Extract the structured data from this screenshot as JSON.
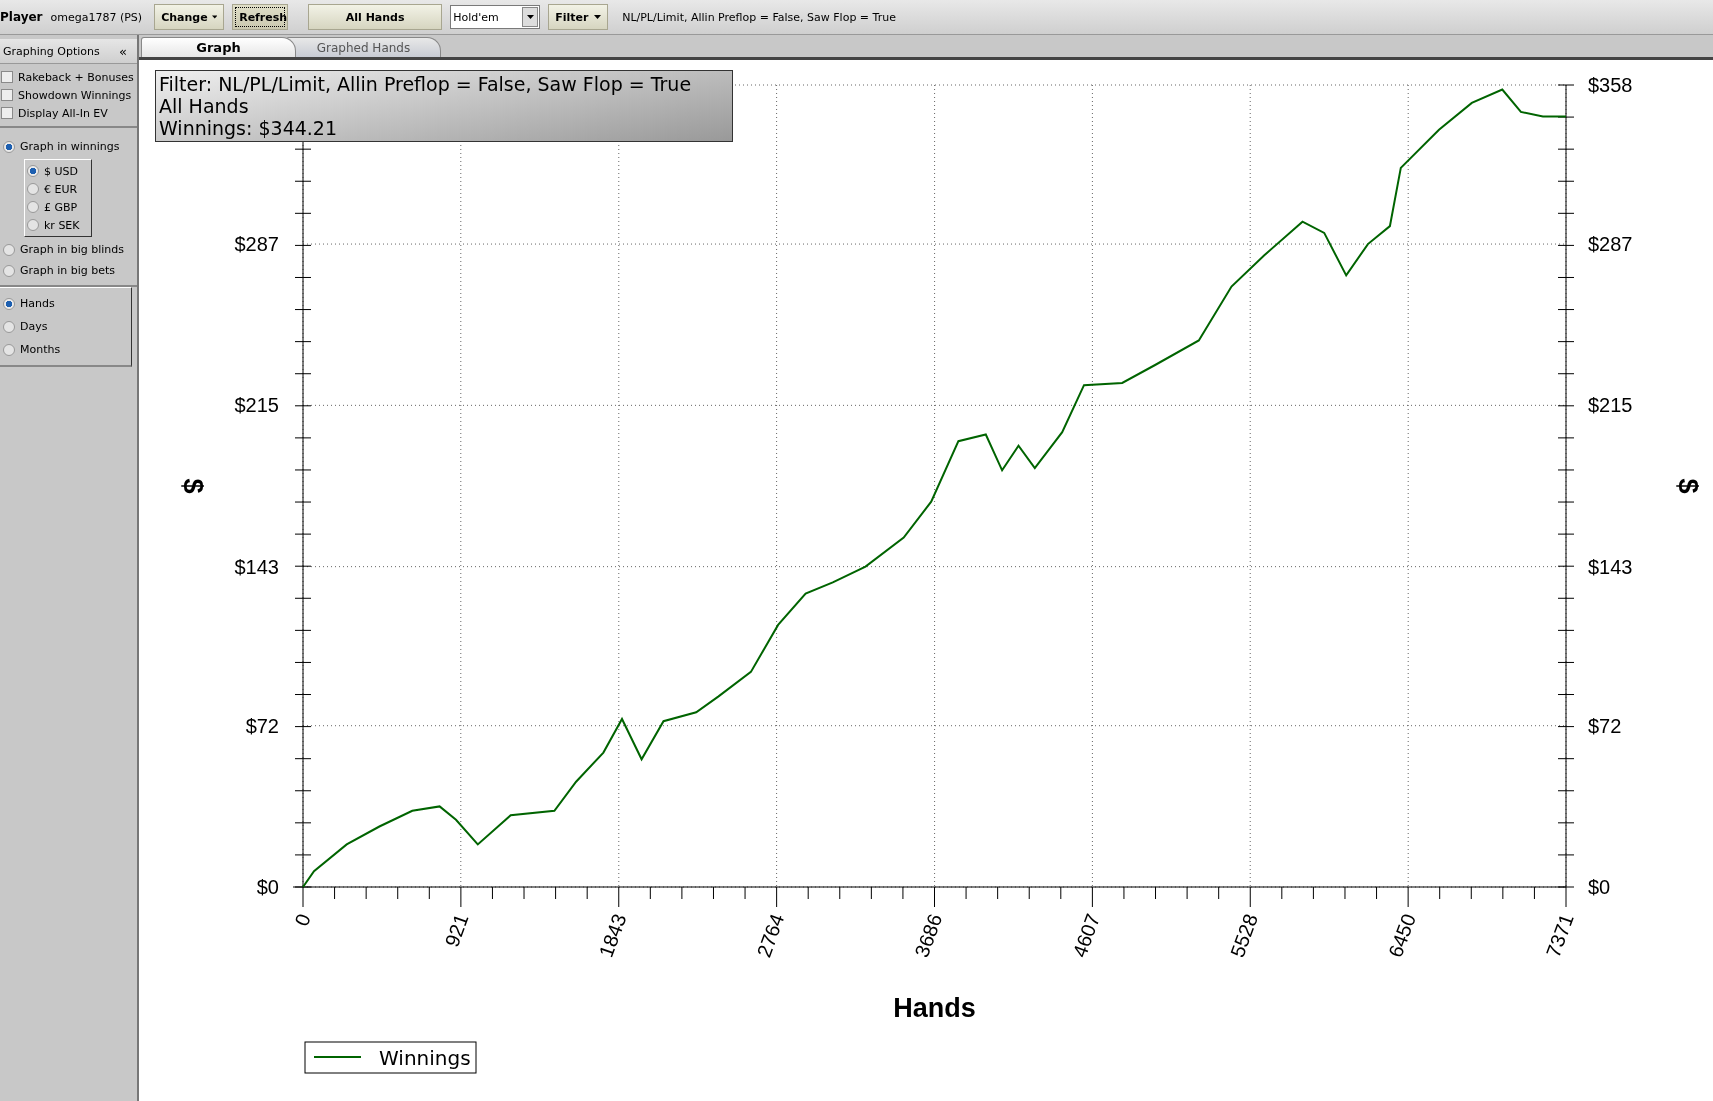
{
  "toolbar": {
    "player_label": "Player",
    "player_name": "omega1787 (PS)",
    "buttons": [
      {
        "label": "Change",
        "kind": "dropdown",
        "pressed": false
      },
      {
        "label": "Refresh",
        "kind": "plain",
        "pressed": true
      },
      {
        "label": "All Hands",
        "kind": "wide",
        "pressed": false
      }
    ],
    "game_select": {
      "value": "Hold'em"
    },
    "filter_button": {
      "label": "Filter"
    },
    "filter_summary": "NL/PL/Limit, Allin Preflop = False, Saw Flop = True"
  },
  "sidebar": {
    "title": "Graphing Options",
    "collapse": "«",
    "checkboxes": [
      {
        "label": "Rakeback + Bonuses",
        "checked": false
      },
      {
        "label": "Showdown Winnings",
        "checked": false
      },
      {
        "label": "Display All-In EV",
        "checked": false
      }
    ],
    "mode_options": [
      {
        "label": "Graph in winnings",
        "selected": true,
        "currencies": [
          {
            "label": "$ USD",
            "selected": true
          },
          {
            "label": "€ EUR",
            "selected": false
          },
          {
            "label": "£ GBP",
            "selected": false
          },
          {
            "label": "kr SEK",
            "selected": false
          }
        ]
      },
      {
        "label": "Graph in big blinds",
        "selected": false
      },
      {
        "label": "Graph in big bets",
        "selected": false
      }
    ],
    "axis_options": [
      {
        "label": "Hands",
        "selected": true
      },
      {
        "label": "Days",
        "selected": false
      },
      {
        "label": "Months",
        "selected": false
      }
    ]
  },
  "tabs": [
    {
      "label": "Graph",
      "selected": true
    },
    {
      "label": "Graphed Hands",
      "selected": false
    }
  ],
  "info_box": [
    "Filter: NL/PL/Limit, Allin Preflop = False, Saw Flop = True",
    "All Hands",
    "Winnings: $344.21"
  ],
  "chart_data": {
    "type": "line",
    "xlabel": "Hands",
    "ylabel": "$",
    "grid": true,
    "x": [
      0,
      64,
      255,
      446,
      638,
      797,
      893,
      1020,
      1212,
      1467,
      1594,
      1753,
      1862,
      1976,
      2104,
      2295,
      2423,
      2614,
      2773,
      2933,
      3092,
      3283,
      3506,
      3666,
      3825,
      3985,
      4080,
      4176,
      4271,
      4431,
      4558,
      4781,
      4973,
      5228,
      5419,
      5610,
      5833,
      5960,
      6088,
      6215,
      6343,
      6407,
      6630,
      6821,
      6999,
      7108,
      7236,
      7371
    ],
    "series": [
      {
        "name": "Winnings",
        "color": "#006400",
        "values": [
          0,
          7,
          19,
          27,
          34,
          36,
          30,
          19,
          32,
          34,
          47,
          60,
          75,
          57,
          74,
          78,
          85,
          96,
          117,
          131,
          136,
          143,
          156,
          172,
          199,
          202,
          186,
          197,
          187,
          203,
          224,
          225,
          233,
          244,
          268,
          282,
          297,
          292,
          273,
          287,
          295,
          321,
          338,
          350,
          356,
          346,
          344,
          344
        ]
      }
    ],
    "xlim": [
      0,
      7371
    ],
    "ylim": [
      0,
      358
    ],
    "xticks": [
      0,
      921,
      1843,
      2764,
      3686,
      4607,
      5528,
      6450,
      7371
    ],
    "yticks": [
      {
        "value": 0,
        "label": "$0"
      },
      {
        "value": 72,
        "label": "$72"
      },
      {
        "value": 143,
        "label": "$143"
      },
      {
        "value": 215,
        "label": "$215"
      },
      {
        "value": 287,
        "label": "$287"
      },
      {
        "value": 358,
        "label": "$358"
      }
    ]
  },
  "right_axis_title": "$"
}
